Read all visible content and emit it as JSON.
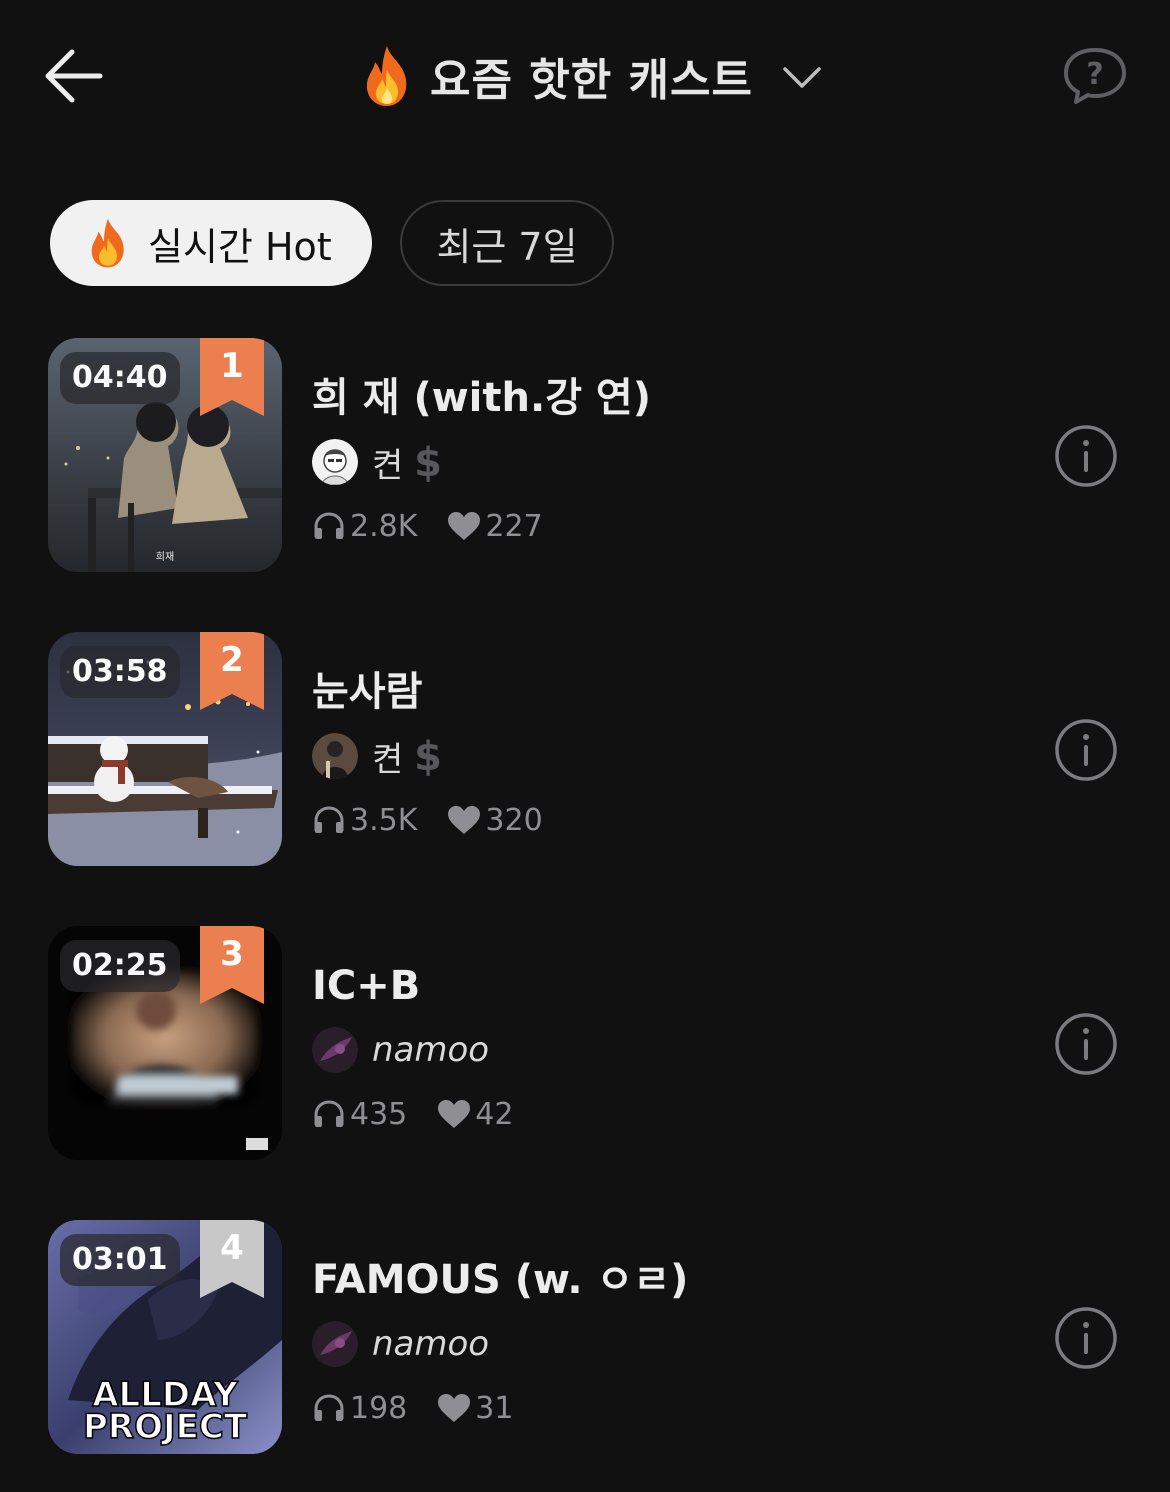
{
  "header": {
    "title": "요즘 핫한 캐스트"
  },
  "filters": {
    "realtime_label": "실시간 Hot",
    "recent_label": "최근 7일"
  },
  "colors": {
    "background": "#111112",
    "rank_badge_top3": "#ec7f4f",
    "rank_badge_other": "#c8c8c8",
    "muted_text": "#8e8e93"
  },
  "items": [
    {
      "rank": "1",
      "duration": "04:40",
      "title": "희 재 (with.강 연)",
      "artist": "켠",
      "plays": "2.8K",
      "likes": "227",
      "thumb_caption": "희재"
    },
    {
      "rank": "2",
      "duration": "03:58",
      "title": "눈사람",
      "artist": "켠",
      "plays": "3.5K",
      "likes": "320"
    },
    {
      "rank": "3",
      "duration": "02:25",
      "title": "IC+B",
      "artist": "namoo",
      "plays": "435",
      "likes": "42"
    },
    {
      "rank": "4",
      "duration": "03:01",
      "title": "FAMOUS (w. ㅇㄹ)",
      "artist": "namoo",
      "plays": "198",
      "likes": "31",
      "thumb_caption_line1": "ALLDAY",
      "thumb_caption_line2": "PROJECT"
    }
  ]
}
